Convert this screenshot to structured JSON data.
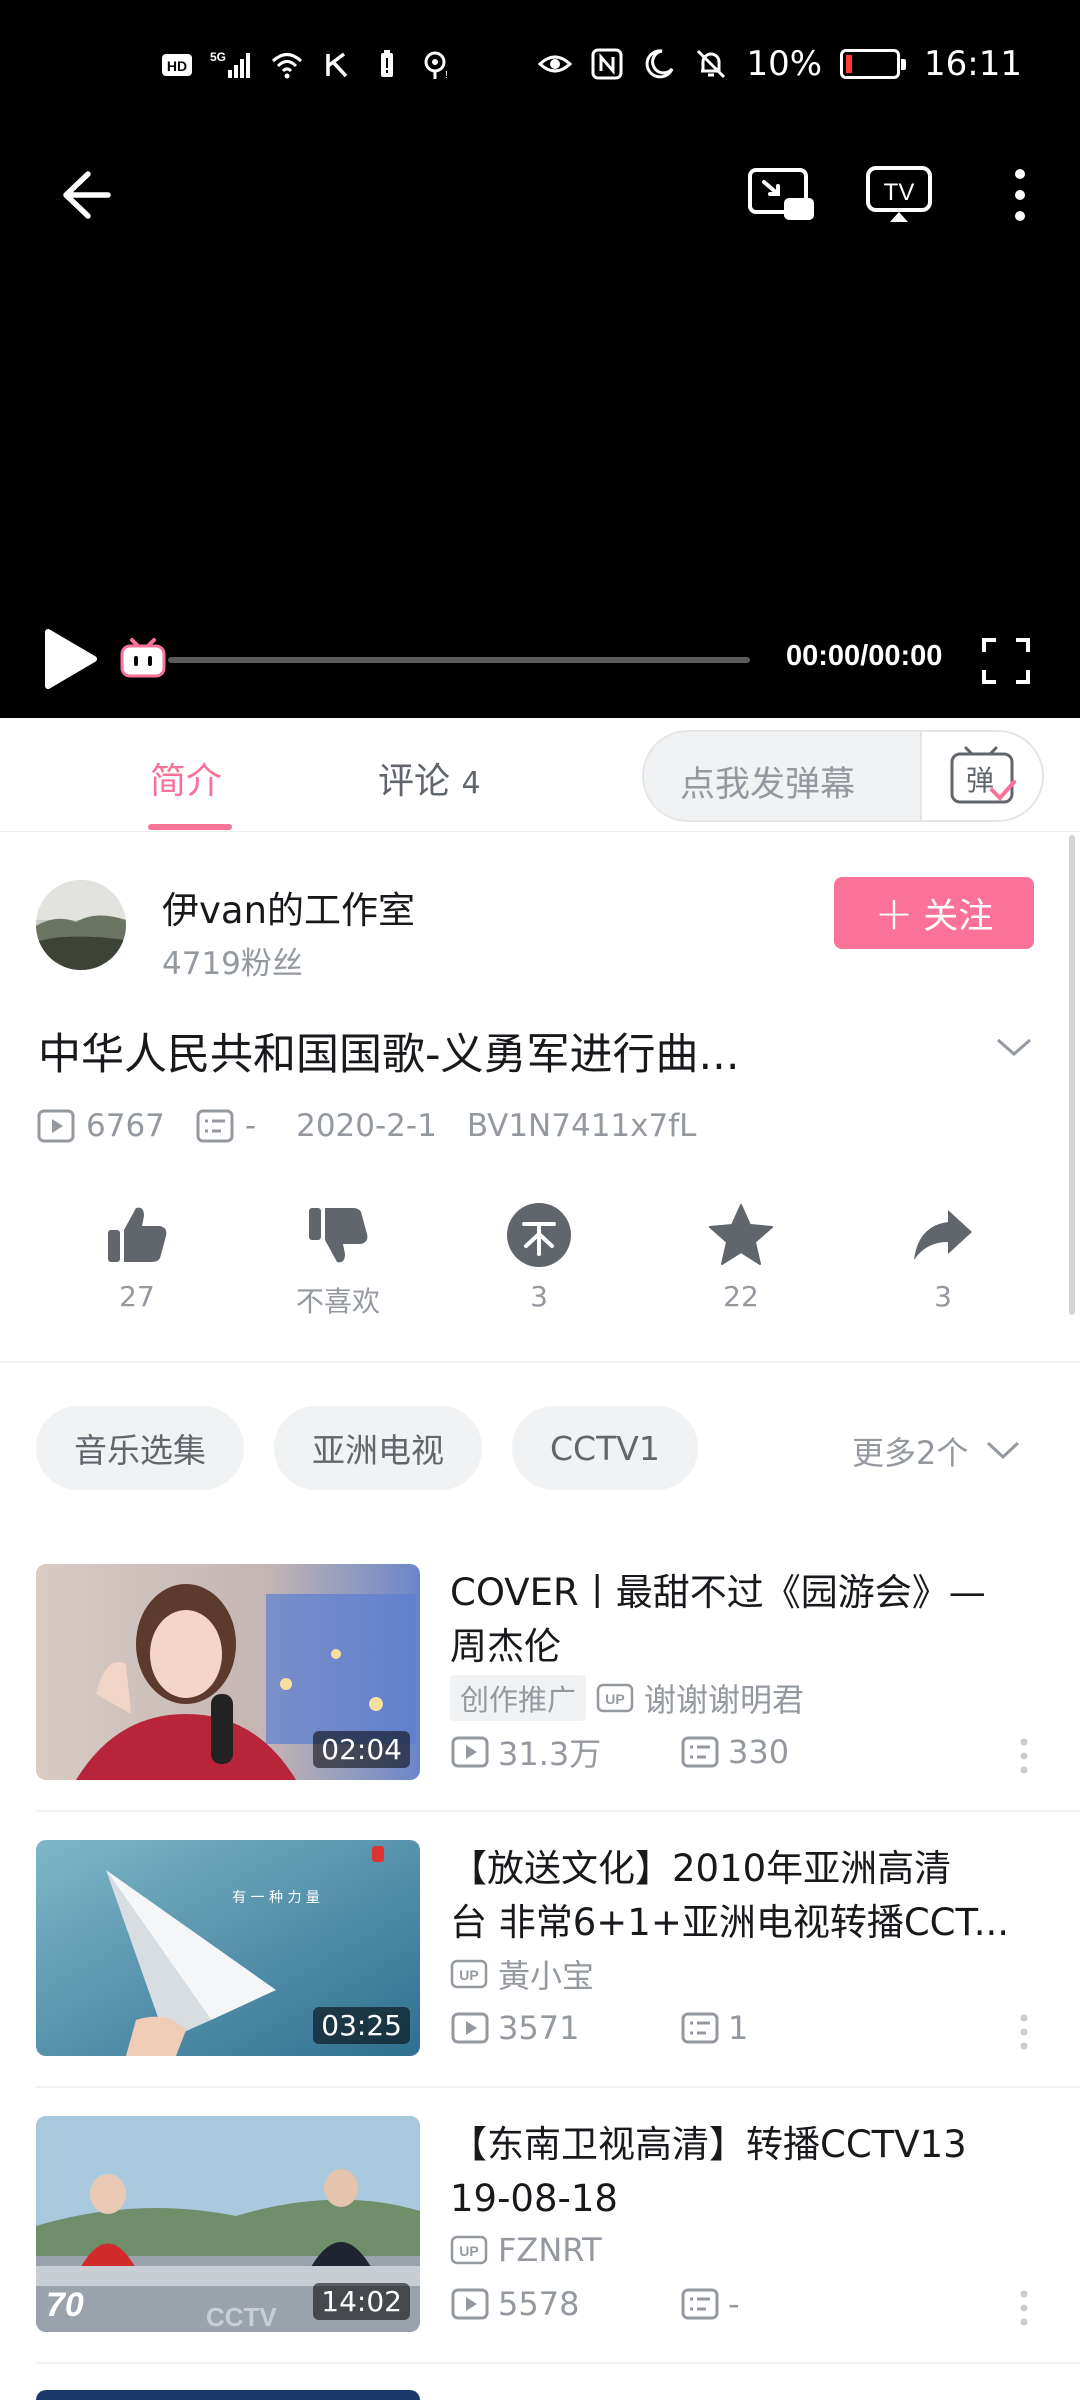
{
  "status_bar": {
    "left_icons": [
      "hd-icon",
      "5g-signal-icon",
      "wifi-icon",
      "k-icon",
      "battery-saver-icon",
      "hotspot-icon"
    ],
    "right_icons": [
      "eye-icon",
      "nfc-icon",
      "moon-icon",
      "mute-icon"
    ],
    "battery": "10%",
    "time": "16:11"
  },
  "player": {
    "time_display": "00:00/00:00",
    "progress": 0
  },
  "tabs": {
    "intro": "简介",
    "comments": "评论",
    "comments_count": "4",
    "danmaku_placeholder": "点我发弹幕",
    "danmaku_button": "弹"
  },
  "uploader": {
    "name": "伊van的工作室",
    "fans": "4719粉丝",
    "follow_label": "关注"
  },
  "video": {
    "title": "中华人民共和国国歌-义勇军进行曲...",
    "views": "6767",
    "danmaku": "-",
    "date": "2020-2-1",
    "bvid": "BV1N7411x7fL"
  },
  "actions": {
    "like": "27",
    "dislike": "不喜欢",
    "coin": "3",
    "favorite": "22",
    "share": "3"
  },
  "tags": {
    "items": [
      "音乐选集",
      "亚洲电视",
      "CCTV1"
    ],
    "more": "更多2个"
  },
  "recommendations": [
    {
      "title_line1": "COVER丨最甜不过《园游会》—",
      "title_line2": "周杰伦",
      "promo": "创作推广",
      "up": "谢谢谢明君",
      "views": "31.3万",
      "danmaku": "330",
      "duration": "02:04"
    },
    {
      "title_line1": "【放送文化】2010年亚洲高清",
      "title_line2": "台 非常6+1+亚洲电视转播CCT...",
      "up": "黃小宝",
      "views": "3571",
      "danmaku": "1",
      "duration": "03:25"
    },
    {
      "title_line1": "【东南卫视高清】转播CCTV13",
      "title_line2": "19-08-18",
      "up": "FZNRT",
      "views": "5578",
      "danmaku": "-",
      "duration": "14:02"
    }
  ],
  "colors": {
    "accent": "#fb7299",
    "player_bg": "#000000",
    "muted_text": "#9499a0",
    "battery_low": "#ff3b30"
  }
}
